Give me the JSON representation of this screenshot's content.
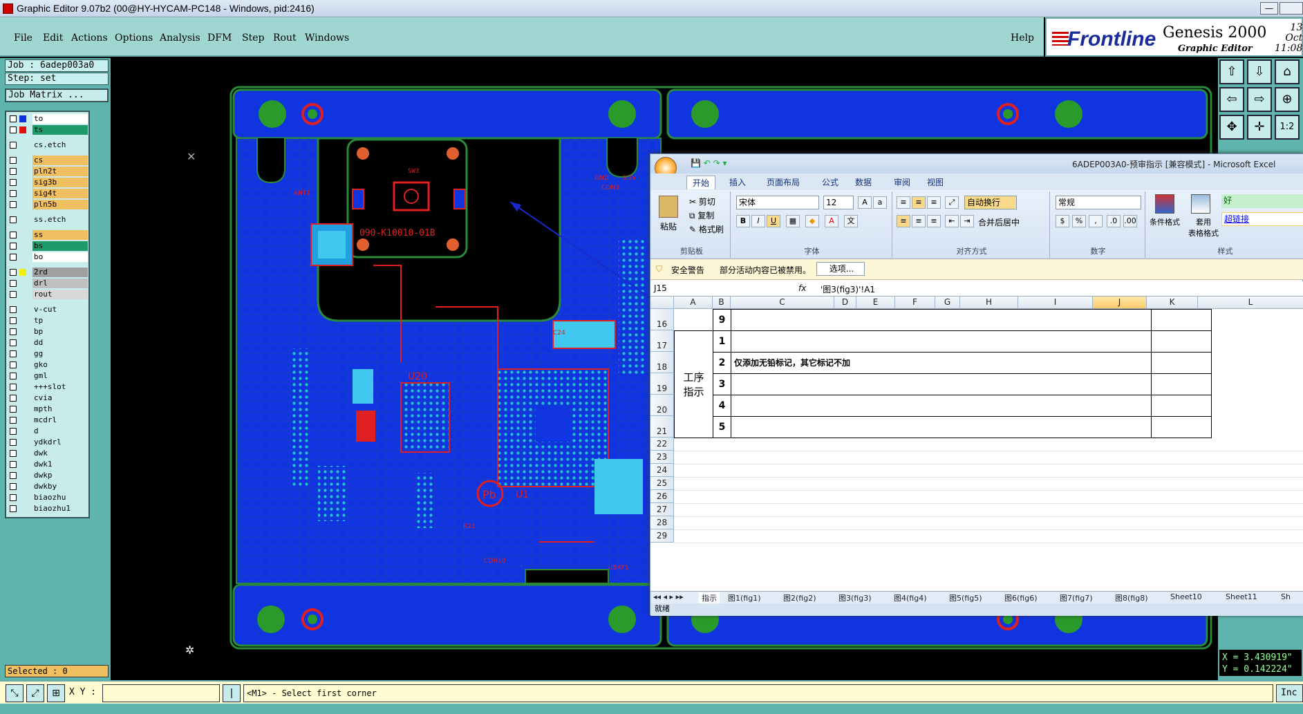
{
  "window": {
    "title": "Graphic Editor 9.07b2 (00@HY-HYCAM-PC148 - Windows, pid:2416)",
    "minimize_label": "—"
  },
  "menu": {
    "items": [
      "File",
      "Edit",
      "Actions",
      "Options",
      "Analysis",
      "DFM",
      "Step",
      "Rout",
      "Windows"
    ],
    "help": "Help"
  },
  "brand": {
    "logo": "Frontline",
    "product": "Genesis 2000",
    "subtitle": "Graphic Editor",
    "date": "13 Oct",
    "time": "11:08"
  },
  "job": {
    "job_label": "Job  :  6adep003a0",
    "step_label": "Step: set",
    "matrix_button": "Job Matrix ..."
  },
  "layers": [
    {
      "name": "to",
      "color": "#ffffff",
      "swatch": "#1030e0"
    },
    {
      "name": "ts",
      "color": "#1f9a6a",
      "swatch": "#e01010"
    },
    {
      "name": "cs.etch",
      "color": "#c8ecec",
      "swatch": ""
    },
    {
      "name": "cs",
      "color": "#f0c060",
      "swatch": ""
    },
    {
      "name": "pln2t",
      "color": "#f0c060",
      "swatch": ""
    },
    {
      "name": "sig3b",
      "color": "#f0c060",
      "swatch": ""
    },
    {
      "name": "sig4t",
      "color": "#f0c060",
      "swatch": ""
    },
    {
      "name": "pln5b",
      "color": "#f0c060",
      "swatch": ""
    },
    {
      "name": "ss.etch",
      "color": "#c8ecec",
      "swatch": ""
    },
    {
      "name": "ss",
      "color": "#f0c060",
      "swatch": ""
    },
    {
      "name": "bs",
      "color": "#1f9a6a",
      "swatch": ""
    },
    {
      "name": "bo",
      "color": "#ffffff",
      "swatch": ""
    },
    {
      "name": "2rd",
      "color": "#a0a0a0",
      "swatch": "#f0f000"
    },
    {
      "name": "drl",
      "color": "#c0c0c0",
      "swatch": ""
    },
    {
      "name": "rout",
      "color": "#d8d8d8",
      "swatch": ""
    },
    {
      "name": "v-cut",
      "color": "#c8ecec",
      "swatch": ""
    },
    {
      "name": "tp",
      "color": "#c8ecec",
      "swatch": ""
    },
    {
      "name": "bp",
      "color": "#c8ecec",
      "swatch": ""
    },
    {
      "name": "dd",
      "color": "#c8ecec",
      "swatch": ""
    },
    {
      "name": "gg",
      "color": "#c8ecec",
      "swatch": ""
    },
    {
      "name": "gko",
      "color": "#c8ecec",
      "swatch": ""
    },
    {
      "name": "gml",
      "color": "#c8ecec",
      "swatch": ""
    },
    {
      "name": "+++slot",
      "color": "#c8ecec",
      "swatch": ""
    },
    {
      "name": "cvia",
      "color": "#c8ecec",
      "swatch": ""
    },
    {
      "name": "mpth",
      "color": "#c8ecec",
      "swatch": ""
    },
    {
      "name": "mcdrl",
      "color": "#c8ecec",
      "swatch": ""
    },
    {
      "name": "d",
      "color": "#c8ecec",
      "swatch": ""
    },
    {
      "name": "ydkdrl",
      "color": "#c8ecec",
      "swatch": ""
    },
    {
      "name": "dwk",
      "color": "#c8ecec",
      "swatch": ""
    },
    {
      "name": "dwk1",
      "color": "#c8ecec",
      "swatch": ""
    },
    {
      "name": "dwkp",
      "color": "#c8ecec",
      "swatch": ""
    },
    {
      "name": "dwkby",
      "color": "#c8ecec",
      "swatch": ""
    },
    {
      "name": "biaozhu",
      "color": "#c8ecec",
      "swatch": ""
    },
    {
      "name": "biaozhu1",
      "color": "#c8ecec",
      "swatch": ""
    }
  ],
  "selected": "Selected : 0",
  "coords": {
    "x": "X = 3.430919\"",
    "y": "Y = 0.142224\""
  },
  "bottom": {
    "xy_label": "X Y :",
    "xy_value": "",
    "prompt": "<M1> - Select first corner",
    "inc": "Inc"
  },
  "pcb": {
    "labels": [
      "090-K10010-01B",
      "SW3",
      "U20",
      "U1",
      "Pb",
      "CON3",
      "GND",
      "3.3V",
      "ANT1",
      "CON10",
      "UBAT1",
      "C24",
      "R21"
    ]
  },
  "excel": {
    "title": "6ADEP003A0-预审指示 [兼容模式] - Microsoft Excel",
    "tabs": [
      "开始",
      "插入",
      "页面布局",
      "公式",
      "数据",
      "审阅",
      "视图"
    ],
    "clipboard": {
      "paste": "粘贴",
      "cut": "剪切",
      "copy": "复制",
      "format_painter": "格式刷",
      "group": "剪贴板"
    },
    "font": {
      "name": "宋体",
      "size": "12",
      "group": "字体"
    },
    "alignment": {
      "wrap": "自动换行",
      "merge": "合并后居中",
      "group": "对齐方式"
    },
    "number": {
      "format": "常规",
      "group": "数字"
    },
    "styles": {
      "conditional": "条件格式",
      "table": "套用\n表格格式",
      "good": "好",
      "hyperlink": "超链接",
      "group": "样式"
    },
    "security": {
      "label": "安全警告",
      "message": "部分活动内容已被禁用。",
      "options": "选项..."
    },
    "namebox": "J15",
    "fx": "fx",
    "formula": "'图3(fig3)'!A1",
    "columns": [
      "A",
      "B",
      "C",
      "D",
      "E",
      "F",
      "G",
      "H",
      "I",
      "J",
      "K",
      "L"
    ],
    "rows": [
      {
        "num": "16",
        "b": "9",
        "c": ""
      },
      {
        "num": "17",
        "b": "1",
        "c": ""
      },
      {
        "num": "18",
        "b": "2",
        "c": "仅添加无铅标记，其它标记不加"
      },
      {
        "num": "19",
        "b": "3",
        "c": ""
      },
      {
        "num": "20",
        "b": "4",
        "c": ""
      },
      {
        "num": "21",
        "b": "5",
        "c": ""
      }
    ],
    "merged_label": "工序\n指示",
    "empty_rows": [
      "22",
      "23",
      "24",
      "25",
      "26",
      "27",
      "28",
      "29"
    ],
    "sheets": [
      "指示",
      "图1(fig1)",
      "图2(fig2)",
      "图3(fig3)",
      "图4(fig4)",
      "图5(fig5)",
      "图6(fig6)",
      "图7(fig7)",
      "图8(fig8)",
      "Sheet10",
      "Sheet11",
      "Sh"
    ],
    "status": "就绪"
  }
}
